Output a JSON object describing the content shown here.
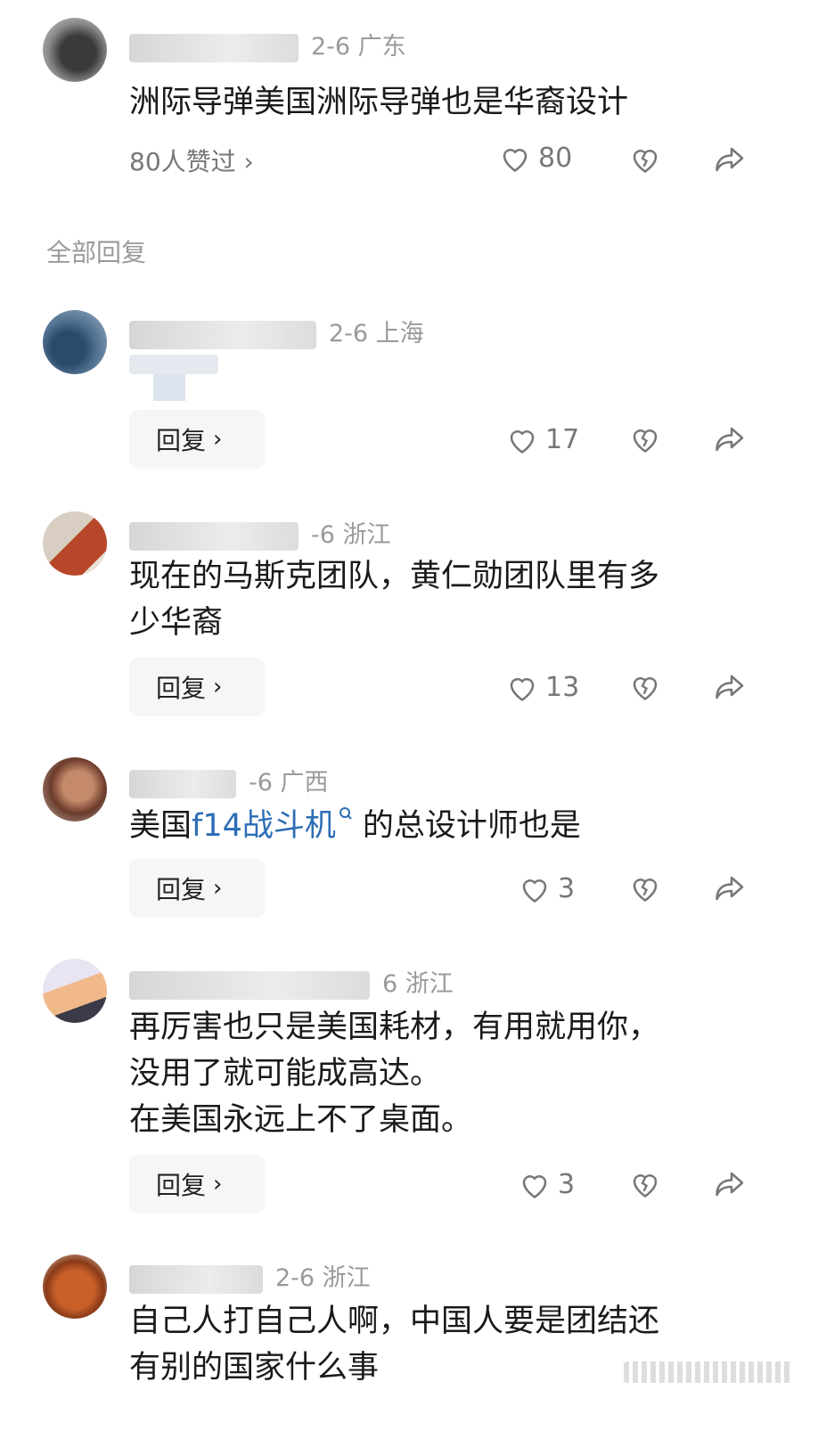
{
  "top_comment": {
    "meta": "2-6 广东",
    "text": "洲际导弹美国洲际导弹也是华裔设计",
    "likers_label": "80人赞过 ›",
    "like_count": "80"
  },
  "section_label": "全部回复",
  "replies": [
    {
      "meta_tail": "2-6 上海",
      "text": "",
      "reply_label": "回复",
      "like_count": "17"
    },
    {
      "meta_tail": "-6 浙江",
      "text_line1": "现在的马斯克团队，黄仁勋团队里有多",
      "text_line2": "少华裔",
      "reply_label": "回复",
      "like_count": "13"
    },
    {
      "meta_tail": "-6 广西",
      "text_pre": "美国",
      "text_link": "f14战斗机",
      "text_post": "的总设计师也是",
      "reply_label": "回复",
      "like_count": "3"
    },
    {
      "meta_tail": "6 浙江",
      "text_line1": "再厉害也只是美国耗材，有用就用你，",
      "text_line2": "没用了就可能成高达。",
      "text_line3": "在美国永远上不了桌面。",
      "reply_label": "回复",
      "like_count": "3"
    },
    {
      "meta_tail": "2-6 浙江",
      "text_line1": "自己人打自己人啊，中国人要是团结还",
      "text_line2": "有别的国家什么事"
    }
  ],
  "icons": {
    "like": "heart-outline-icon",
    "dislike": "broken-heart-icon",
    "share": "share-arrow-icon"
  },
  "colors": {
    "link": "#2c6eb5",
    "muted": "#9a9a9a",
    "text": "#1a1a1a"
  }
}
